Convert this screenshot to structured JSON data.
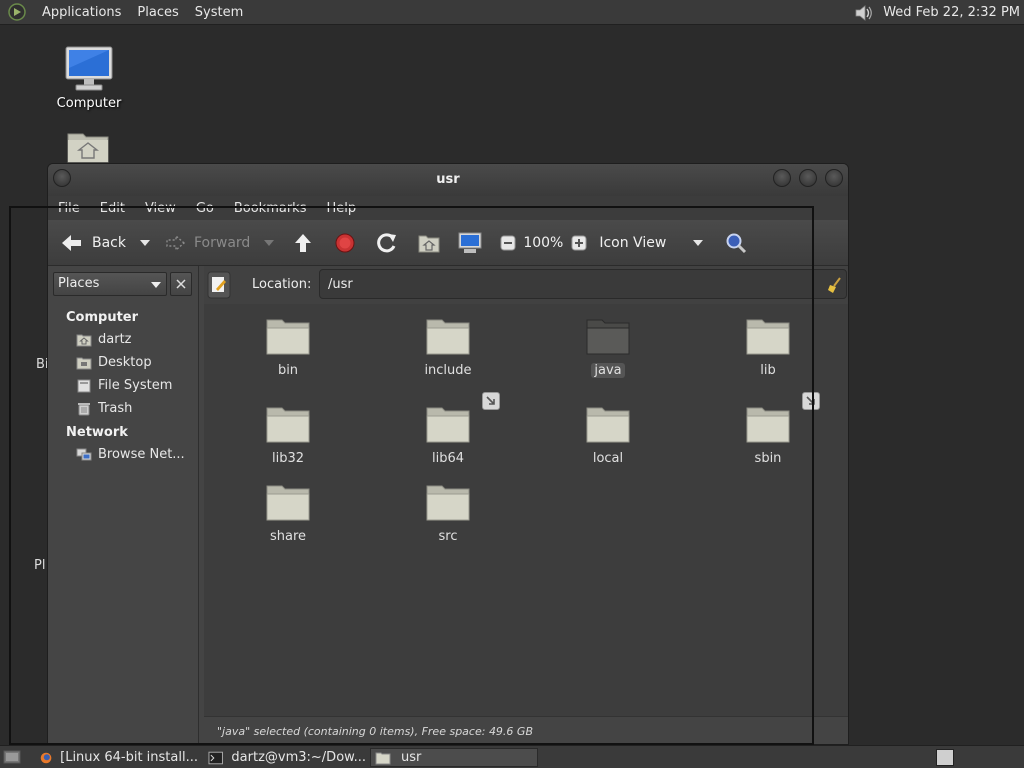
{
  "top_panel": {
    "menus": [
      "Applications",
      "Places",
      "System"
    ],
    "clock": "Wed Feb 22,  2:32 PM"
  },
  "desktop": {
    "computer_label": "Computer",
    "partial_labels": [
      "Bi",
      "Pl"
    ]
  },
  "window": {
    "title": "usr",
    "menus": [
      "File",
      "Edit",
      "View",
      "Go",
      "Bookmarks",
      "Help"
    ],
    "toolbar": {
      "back": "Back",
      "forward": "Forward",
      "zoom": "100%",
      "view_mode": "Icon View"
    },
    "sidebar": {
      "selector": "Places",
      "computer_header": "Computer",
      "computer_items": [
        "dartz",
        "Desktop",
        "File System",
        "Trash"
      ],
      "network_header": "Network",
      "network_items": [
        "Browse Net..."
      ]
    },
    "location": {
      "label": "Location:",
      "value": "/usr"
    },
    "items": [
      {
        "name": "bin",
        "link": false,
        "selected": false
      },
      {
        "name": "include",
        "link": false,
        "selected": false
      },
      {
        "name": "java",
        "link": false,
        "selected": true
      },
      {
        "name": "lib",
        "link": false,
        "selected": false
      },
      {
        "name": "lib32",
        "link": false,
        "selected": false
      },
      {
        "name": "lib64",
        "link": true,
        "selected": false
      },
      {
        "name": "local",
        "link": false,
        "selected": false
      },
      {
        "name": "sbin",
        "link": true,
        "selected": false
      },
      {
        "name": "share",
        "link": false,
        "selected": false
      },
      {
        "name": "src",
        "link": false,
        "selected": false
      }
    ],
    "status": "\"java\" selected (containing 0 items), Free space: 49.6 GB"
  },
  "taskbar": {
    "tasks": [
      "[Linux 64-bit install...",
      "dartz@vm3:~/Dow...",
      "usr"
    ]
  },
  "colors": {
    "panel": "#3a3a3a",
    "window": "#444444",
    "content": "#3d3d3d",
    "folder": "#d6d6c8"
  }
}
